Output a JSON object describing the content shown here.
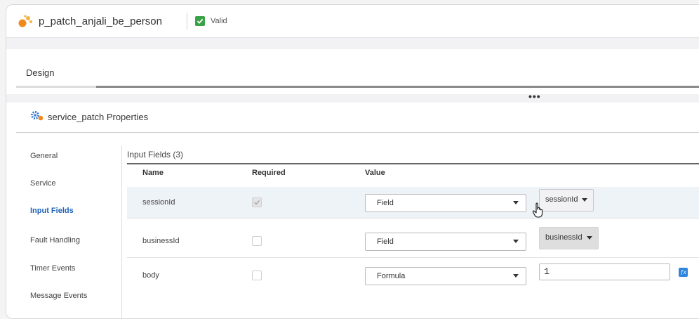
{
  "header": {
    "process_name": "p_patch_anjali_be_person",
    "status_label": "Valid",
    "status_color": "#3aa247"
  },
  "design": {
    "title": "Design"
  },
  "more_menu": "•••",
  "properties": {
    "title": "service_patch Properties",
    "nav": [
      {
        "label": "General"
      },
      {
        "label": "Service"
      },
      {
        "label": "Input Fields",
        "active": true
      },
      {
        "label": "Fault Handling"
      },
      {
        "label": "Timer Events"
      },
      {
        "label": "Message Events"
      }
    ],
    "input_fields": {
      "title": "Input Fields (3)",
      "columns": [
        "Name",
        "Required",
        "Value"
      ],
      "rows": [
        {
          "name": "sessionId",
          "required": true,
          "value_type": "Field",
          "value": "sessionId",
          "highlighted": true
        },
        {
          "name": "businessId",
          "required": false,
          "value_type": "Field",
          "value": "businessId"
        },
        {
          "name": "body",
          "required": false,
          "value_type": "Formula",
          "value": "1",
          "fx_label": "ƒx"
        }
      ]
    }
  },
  "icons": [
    "process-icon",
    "check-icon",
    "service-gear-icon",
    "chevron-down-icon",
    "hand-pointer-icon",
    "formula-editor-icon"
  ]
}
